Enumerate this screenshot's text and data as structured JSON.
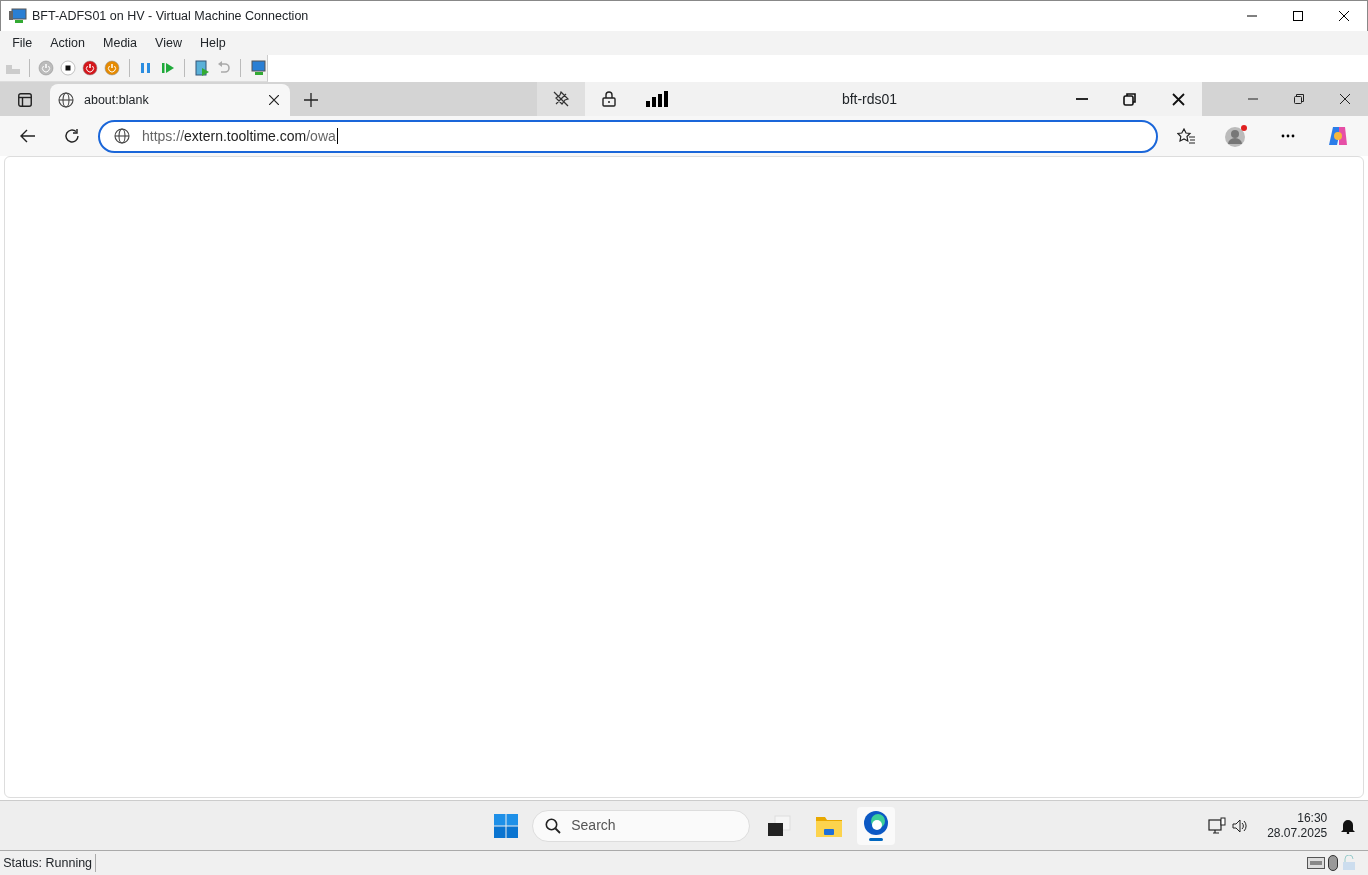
{
  "window": {
    "title": "BFT-ADFS01 on HV - Virtual Machine Connection"
  },
  "menu": [
    "File",
    "Action",
    "Media",
    "View",
    "Help"
  ],
  "browser": {
    "tabs": [
      {
        "label": "about:blank",
        "selected": true
      }
    ],
    "url": {
      "scheme": "https://",
      "host": "extern.tooltime.com",
      "path": "/owa"
    }
  },
  "rdp_bar": {
    "title": "bft-rds01"
  },
  "taskbar": {
    "search": {
      "placeholder": "Search"
    },
    "time": "16:30",
    "date": "28.07.2025"
  },
  "status_bar": "Status: Running"
}
